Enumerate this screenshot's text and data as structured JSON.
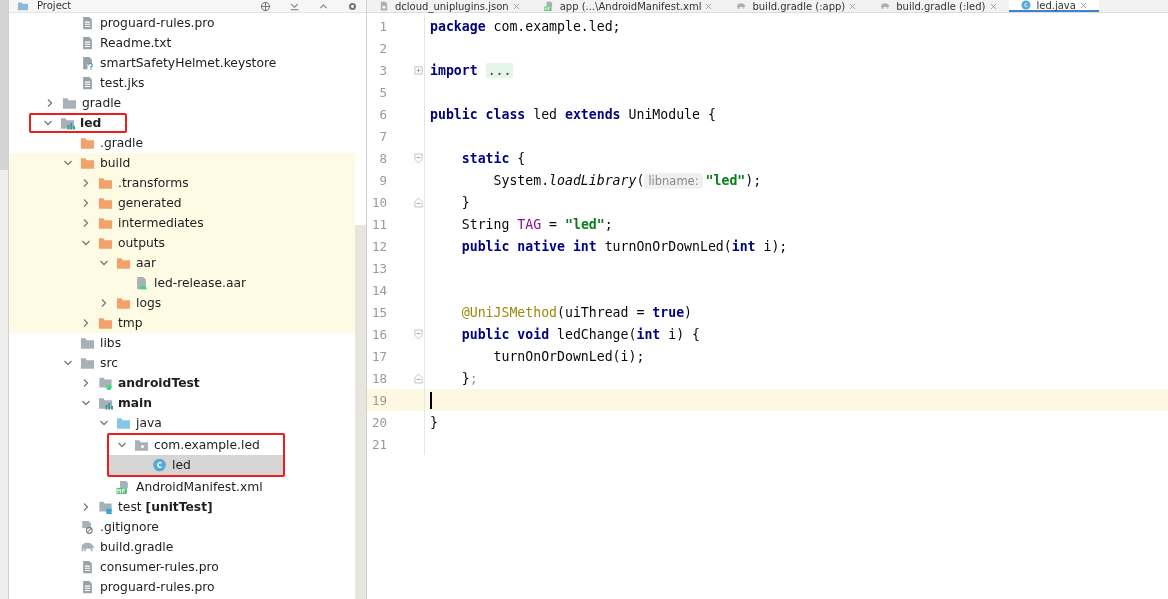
{
  "project_panel": {
    "title": "Project"
  },
  "editor_tabs": [
    {
      "label": "dcloud_uniplugins.json",
      "kind": "json",
      "selected": false
    },
    {
      "label": "app (...\\AndroidManifest.xml",
      "kind": "manifest",
      "selected": false
    },
    {
      "label": "build.gradle (:app)",
      "kind": "gradle",
      "selected": false
    },
    {
      "label": "build.gradle (:led)",
      "kind": "gradle",
      "selected": false
    },
    {
      "label": "led.java",
      "kind": "class",
      "selected": true
    }
  ],
  "tree": {
    "cut_off_parent_children": [
      {
        "label": "proguard-rules.pro",
        "kind": "text"
      },
      {
        "label": "Readme.txt",
        "kind": "text"
      },
      {
        "label": "smartSafetyHelmet.keystore",
        "kind": "unknown"
      },
      {
        "label": "test.jks",
        "kind": "text"
      }
    ],
    "items": [
      {
        "label": "gradle",
        "kind": "folder",
        "expanded": false
      },
      {
        "label": "led",
        "kind": "module",
        "bold": true,
        "expanded": true,
        "annotated": true,
        "children": [
          {
            "label": ".gradle",
            "kind": "folder-excluded"
          },
          {
            "label": "build",
            "kind": "folder-excluded",
            "excluded": true,
            "expanded": true,
            "children": [
              {
                "label": ".transforms",
                "kind": "folder-excluded",
                "expanded": false
              },
              {
                "label": "generated",
                "kind": "folder-excluded",
                "expanded": false
              },
              {
                "label": "intermediates",
                "kind": "folder-excluded",
                "expanded": false
              },
              {
                "label": "outputs",
                "kind": "folder-excluded",
                "expanded": true,
                "children": [
                  {
                    "label": "aar",
                    "kind": "folder-excluded",
                    "expanded": true,
                    "children": [
                      {
                        "label": "led-release.aar",
                        "kind": "aar"
                      }
                    ]
                  },
                  {
                    "label": "logs",
                    "kind": "folder-excluded",
                    "expanded": false
                  }
                ]
              },
              {
                "label": "tmp",
                "kind": "folder-excluded",
                "expanded": false
              }
            ]
          },
          {
            "label": "libs",
            "kind": "folder"
          },
          {
            "label": "src",
            "kind": "folder",
            "expanded": true,
            "children": [
              {
                "label": "androidTest",
                "kind": "test-android",
                "bold": true,
                "expanded": false
              },
              {
                "label": "main",
                "kind": "module",
                "bold": true,
                "expanded": true,
                "children": [
                  {
                    "label": "java",
                    "kind": "source-root",
                    "expanded": true,
                    "children": [
                      {
                        "label": "com.example.led",
                        "kind": "package",
                        "expanded": true,
                        "annotated": true,
                        "children": [
                          {
                            "label": "led",
                            "kind": "class",
                            "selected": true,
                            "annotated": true
                          }
                        ]
                      }
                    ]
                  },
                  {
                    "label": "AndroidManifest.xml",
                    "kind": "manifest"
                  }
                ]
              },
              {
                "label": "test **[unitTest]**",
                "kind": "test-unit",
                "expanded": false
              }
            ]
          },
          {
            "label": ".gitignore",
            "kind": "ignore"
          },
          {
            "label": "build.gradle",
            "kind": "gradle"
          },
          {
            "label": "consumer-rules.pro",
            "kind": "text"
          },
          {
            "label": "proguard-rules.pro",
            "kind": "text"
          }
        ]
      }
    ]
  },
  "editor": {
    "lines": [
      {
        "number": "1",
        "tokens": [
          {
            "kind": "keyword",
            "text": "package"
          },
          {
            "kind": "plain",
            "text": " com.example.led;"
          }
        ]
      },
      {
        "number": "2"
      },
      {
        "number": "3",
        "folded": true,
        "tokens": [
          {
            "kind": "keyword",
            "text": "import"
          },
          {
            "kind": "folded",
            "text": "..."
          }
        ]
      },
      {
        "number": "5"
      },
      {
        "number": "6",
        "tokens": [
          {
            "kind": "keyword",
            "text": "public class"
          },
          {
            "kind": "plain",
            "text": " led "
          },
          {
            "kind": "keyword",
            "text": "extends"
          },
          {
            "kind": "plain",
            "text": " UniModule {"
          }
        ]
      },
      {
        "number": "7"
      },
      {
        "number": "8",
        "fold_start": true,
        "tokens": [
          {
            "kind": "keyword",
            "text": "    static"
          },
          {
            "kind": "plain",
            "text": " {"
          }
        ]
      },
      {
        "number": "9",
        "tokens": [
          {
            "kind": "plain",
            "text": "        System."
          },
          {
            "kind": "method",
            "text": "loadLibrary"
          },
          {
            "kind": "plain",
            "text": "("
          },
          {
            "kind": "hint",
            "text": "libname:"
          },
          {
            "kind": "string",
            "text": "\"led\""
          },
          {
            "kind": "plain",
            "text": ");"
          }
        ]
      },
      {
        "number": "10",
        "fold_end": true,
        "tokens": [
          {
            "kind": "plain",
            "text": "    }"
          }
        ]
      },
      {
        "number": "11",
        "tokens": [
          {
            "kind": "plain",
            "text": "    String "
          },
          {
            "kind": "field",
            "text": "TAG"
          },
          {
            "kind": "plain",
            "text": " = "
          },
          {
            "kind": "string",
            "text": "\"led\""
          },
          {
            "kind": "plain",
            "text": ";"
          }
        ]
      },
      {
        "number": "12",
        "tokens": [
          {
            "kind": "keyword",
            "text": "    public native int"
          },
          {
            "kind": "plain",
            "text": " turnOnOrDownLed("
          },
          {
            "kind": "keyword",
            "text": "int"
          },
          {
            "kind": "plain",
            "text": " i);"
          }
        ]
      },
      {
        "number": "13"
      },
      {
        "number": "14"
      },
      {
        "number": "15",
        "tokens": [
          {
            "kind": "annotation",
            "text": "    @UniJSMethod"
          },
          {
            "kind": "plain",
            "text": "(uiThread = "
          },
          {
            "kind": "keyword",
            "text": "true"
          },
          {
            "kind": "plain",
            "text": ")"
          }
        ]
      },
      {
        "number": "16",
        "fold_start": true,
        "tokens": [
          {
            "kind": "keyword",
            "text": "    public void"
          },
          {
            "kind": "plain",
            "text": " ledChange("
          },
          {
            "kind": "keyword",
            "text": "int"
          },
          {
            "kind": "plain",
            "text": " i) {"
          }
        ]
      },
      {
        "number": "17",
        "tokens": [
          {
            "kind": "plain",
            "text": "        turnOnOrDownLed(i);"
          }
        ]
      },
      {
        "number": "18",
        "fold_end": true,
        "tokens": [
          {
            "kind": "plain",
            "text": "    }"
          },
          {
            "kind": "unused",
            "text": ";"
          }
        ]
      },
      {
        "number": "19",
        "current": true
      },
      {
        "number": "20",
        "tokens": [
          {
            "kind": "plain",
            "text": "}"
          }
        ]
      },
      {
        "number": "21"
      }
    ]
  }
}
